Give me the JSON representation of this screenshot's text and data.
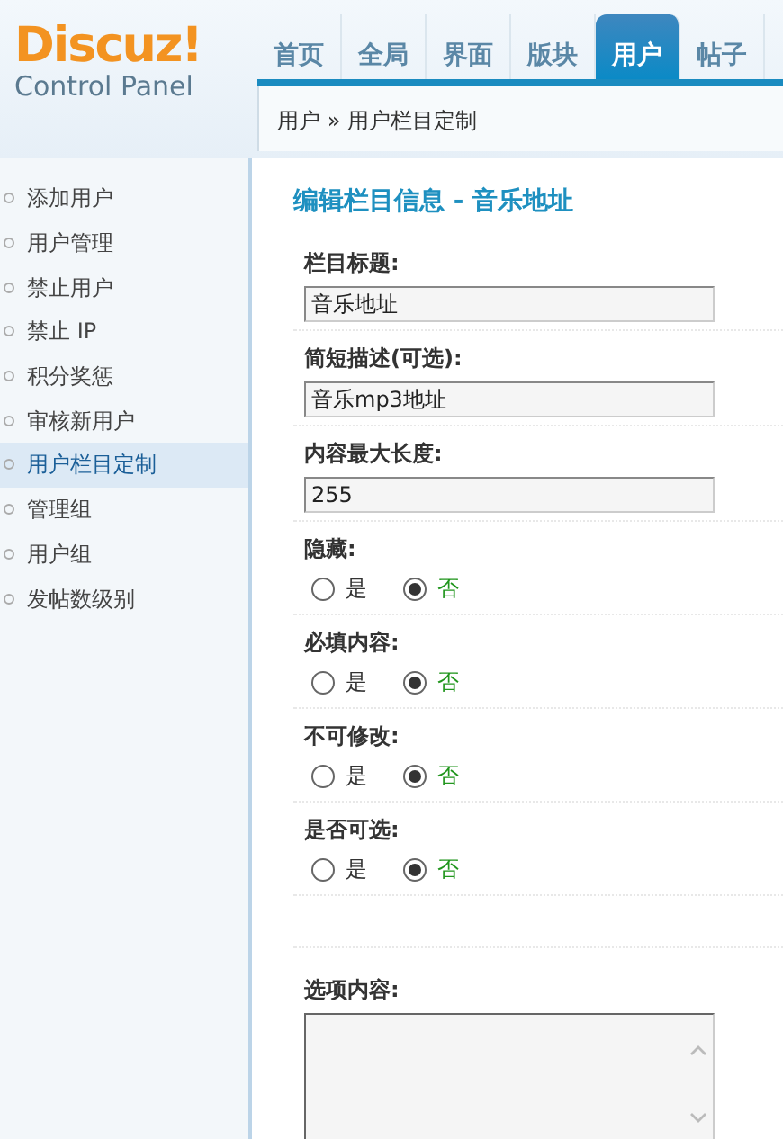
{
  "logo": {
    "title": "Discuz!",
    "subtitle": "Control Panel"
  },
  "nav_tabs": [
    {
      "label": "首页",
      "selected": false
    },
    {
      "label": "全局",
      "selected": false
    },
    {
      "label": "界面",
      "selected": false
    },
    {
      "label": "版块",
      "selected": false
    },
    {
      "label": "用户",
      "selected": true
    },
    {
      "label": "帖子",
      "selected": false
    }
  ],
  "breadcrumb": {
    "section": "用户",
    "separator": "»",
    "page": "用户栏目定制"
  },
  "sidebar": {
    "items": [
      {
        "label": "添加用户",
        "selected": false
      },
      {
        "label": "用户管理",
        "selected": false
      },
      {
        "label": "禁止用户",
        "selected": false
      },
      {
        "label": "禁止 IP",
        "selected": false
      },
      {
        "label": "积分奖惩",
        "selected": false
      },
      {
        "label": "审核新用户",
        "selected": false
      },
      {
        "label": "用户栏目定制",
        "selected": true
      },
      {
        "label": "管理组",
        "selected": false
      },
      {
        "label": "用户组",
        "selected": false
      },
      {
        "label": "发帖数级别",
        "selected": false
      }
    ]
  },
  "form": {
    "title": "编辑栏目信息 - 音乐地址",
    "fields": [
      {
        "kind": "text",
        "label": "栏目标题:",
        "value": "音乐地址"
      },
      {
        "kind": "text",
        "label": "简短描述(可选):",
        "value": "音乐mp3地址"
      },
      {
        "kind": "text",
        "label": "内容最大长度:",
        "value": "255"
      },
      {
        "kind": "radio",
        "label": "隐藏:",
        "options": [
          {
            "label": "是",
            "selected": false
          },
          {
            "label": "否",
            "selected": true
          }
        ]
      },
      {
        "kind": "radio",
        "label": "必填内容:",
        "options": [
          {
            "label": "是",
            "selected": false
          },
          {
            "label": "否",
            "selected": true
          }
        ]
      },
      {
        "kind": "radio",
        "label": "不可修改:",
        "options": [
          {
            "label": "是",
            "selected": false
          },
          {
            "label": "否",
            "selected": true
          }
        ]
      },
      {
        "kind": "radio",
        "label": "是否可选:",
        "options": [
          {
            "label": "是",
            "selected": false
          },
          {
            "label": "否",
            "selected": true
          }
        ]
      },
      {
        "kind": "textarea",
        "label": "选项内容:"
      }
    ]
  }
}
